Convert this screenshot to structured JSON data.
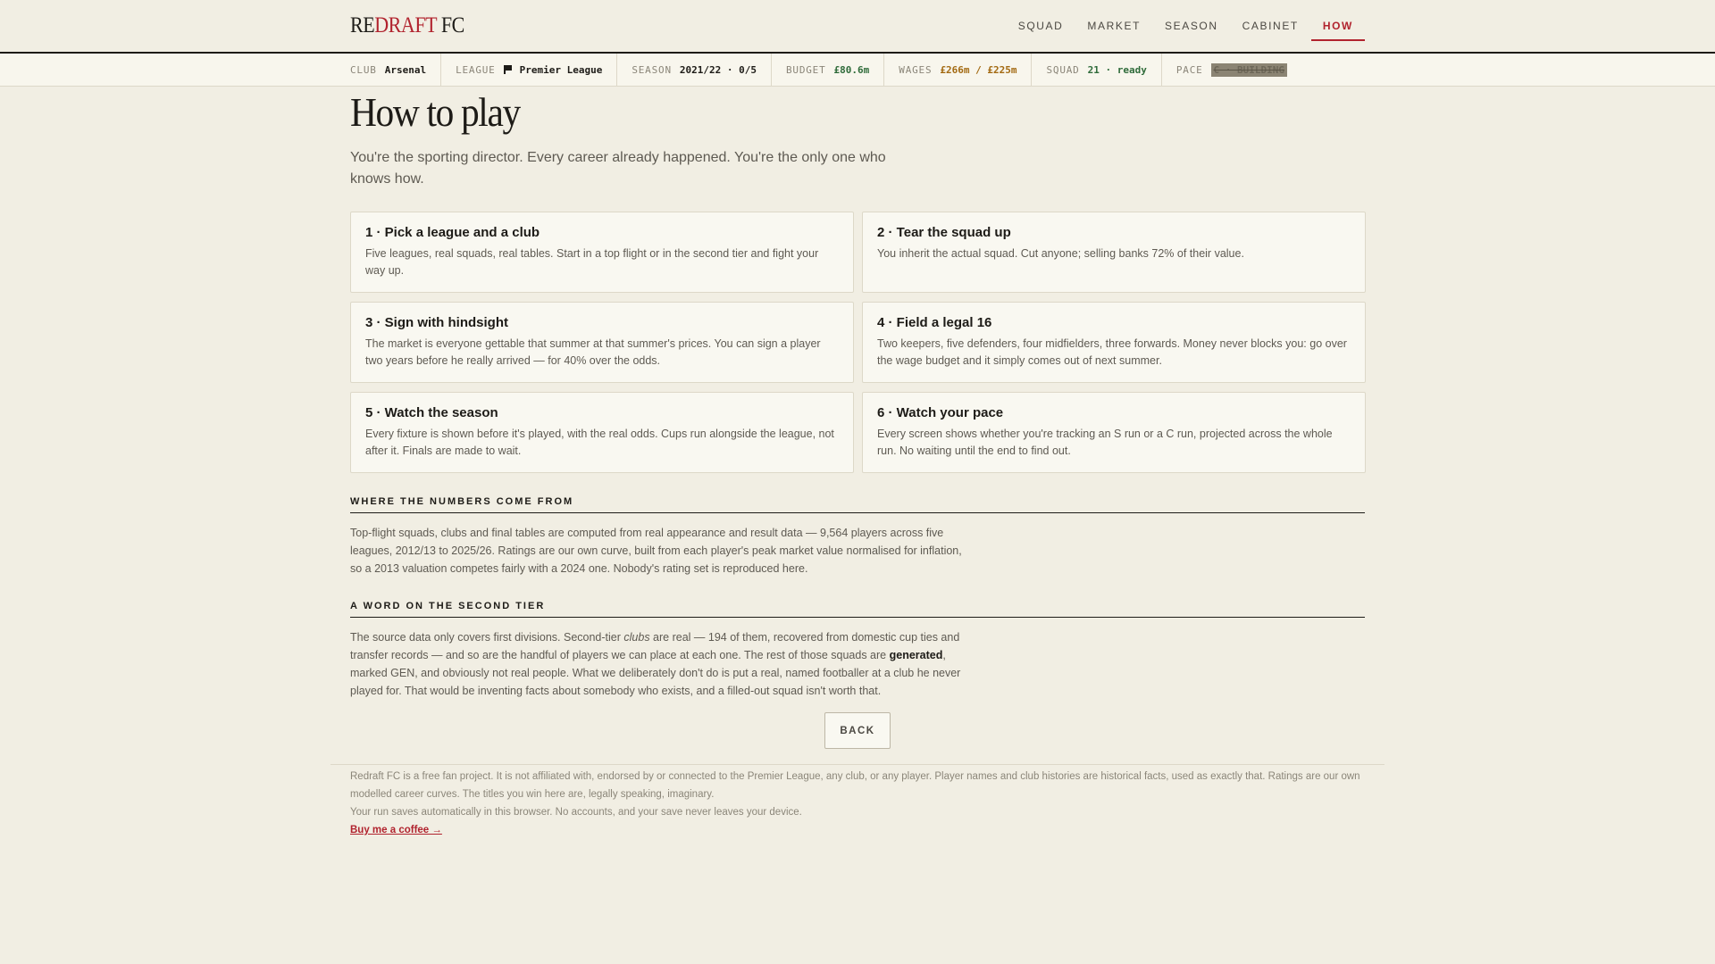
{
  "brand": {
    "part1": "RE",
    "part2": "DRAFT",
    "part3": " FC"
  },
  "nav": {
    "items": [
      {
        "label": "SQUAD"
      },
      {
        "label": "MARKET"
      },
      {
        "label": "SEASON"
      },
      {
        "label": "CABINET"
      },
      {
        "label": "HOW",
        "active": true
      }
    ]
  },
  "status": {
    "club_key": "CLUB",
    "club_val": "Arsenal",
    "league_key": "LEAGUE",
    "league_val": "Premier League",
    "season_key": "SEASON",
    "season_val": "2021/22 · 0/5",
    "budget_key": "BUDGET",
    "budget_val": "£80.6m",
    "wages_key": "WAGES",
    "wages_val": "£266m / £225m",
    "squad_key": "SQUAD",
    "squad_val": "21 · ready",
    "pace_key": "PACE",
    "pace_val": "C · BUILDING"
  },
  "page": {
    "title": "How to play",
    "lead": "You're the sporting director. Every career already happened. You're the only one who knows how."
  },
  "steps": [
    {
      "title": "1 · Pick a league and a club",
      "body": "Five leagues, real squads, real tables. Start in a top flight or in the second tier and fight your way up."
    },
    {
      "title": "2 · Tear the squad up",
      "body": "You inherit the actual squad. Cut anyone; selling banks 72% of their value."
    },
    {
      "title": "3 · Sign with hindsight",
      "body": "The market is everyone gettable that summer at that summer's prices. You can sign a player two years before he really arrived — for 40% over the odds."
    },
    {
      "title": "4 · Field a legal 16",
      "body": "Two keepers, five defenders, four midfielders, three forwards. Money never blocks you: go over the wage budget and it simply comes out of next summer."
    },
    {
      "title": "5 · Watch the season",
      "body": "Every fixture is shown before it's played, with the real odds. Cups run alongside the league, not after it. Finals are made to wait."
    },
    {
      "title": "6 · Watch your pace",
      "body": "Every screen shows whether you're tracking an S run or a C run, projected across the whole run. No waiting until the end to find out."
    }
  ],
  "numbers": {
    "heading": "WHERE THE NUMBERS COME FROM",
    "body": "Top-flight squads, clubs and final tables are computed from real appearance and result data — 9,564 players across five leagues, 2012/13 to 2025/26. Ratings are our own curve, built from each player's peak market value normalised for inflation, so a 2013 valuation competes fairly with a 2024 one. Nobody's rating set is reproduced here."
  },
  "second_tier": {
    "heading": "A WORD ON THE SECOND TIER",
    "p1": "The source data only covers first divisions. Second-tier ",
    "p1_em": "clubs",
    "p2": " are real — 194 of them, recovered from domestic cup ties and transfer records — and so are the handful of players we can place at each one. The rest of those squads are ",
    "p2_b": "generated",
    "p3": ", marked GEN, and obviously not real people. What we deliberately don't do is put a real, named footballer at a club he never played for. That would be inventing facts about somebody who exists, and a filled-out squad isn't worth that."
  },
  "back_label": "BACK",
  "footer": {
    "line1": "Redraft FC is a free fan project. It is not affiliated with, endorsed by or connected to the Premier League, any club, or any player. Player names and club histories are historical facts, used as exactly that. Ratings are our own modelled career curves. The titles you win here are, legally speaking, imaginary.",
    "line2": "Your run saves automatically in this browser. No accounts, and your save never leaves your device.",
    "coffee": "Buy me a coffee →"
  },
  "colors": {
    "accent": "#b1232e",
    "background": "#f1eee3",
    "green": "#2f6b3a",
    "amber": "#a36a12"
  }
}
